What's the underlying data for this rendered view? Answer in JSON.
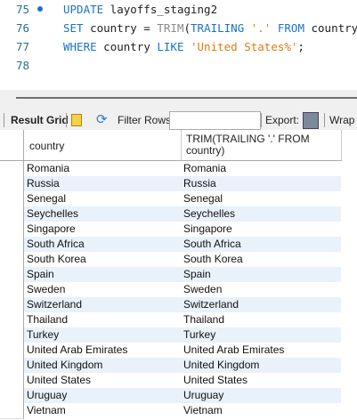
{
  "editor": {
    "lines": [
      {
        "num": "75",
        "parts": [
          [
            "kw",
            "UPDATE"
          ],
          [
            "tx",
            " layoffs_staging2"
          ]
        ]
      },
      {
        "num": "76",
        "parts": [
          [
            "kw",
            "SET"
          ],
          [
            "tx",
            " country = "
          ],
          [
            "fn",
            "TRIM"
          ],
          [
            "tx",
            "("
          ],
          [
            "kw",
            "TRAILING"
          ],
          [
            "str",
            " '.' "
          ],
          [
            "kw",
            "FROM"
          ],
          [
            "tx",
            " country)"
          ]
        ]
      },
      {
        "num": "77",
        "parts": [
          [
            "kw",
            "WHERE"
          ],
          [
            "tx",
            " country "
          ],
          [
            "kw",
            "LIKE"
          ],
          [
            "str",
            " 'United States%'"
          ],
          [
            "tx",
            ";"
          ]
        ]
      },
      {
        "num": "78",
        "parts": []
      }
    ]
  },
  "toolbar": {
    "result_grid": "Result Grid",
    "filter_rows": "Filter Rows:",
    "filter_value": "",
    "export": "Export:",
    "wrap": "Wrap C"
  },
  "grid": {
    "columns": [
      "country",
      "TRIM(TRAILING '.' FROM country)"
    ],
    "rows": [
      [
        "Romania",
        "Romania"
      ],
      [
        "Russia",
        "Russia"
      ],
      [
        "Senegal",
        "Senegal"
      ],
      [
        "Seychelles",
        "Seychelles"
      ],
      [
        "Singapore",
        "Singapore"
      ],
      [
        "South Africa",
        "South Africa"
      ],
      [
        "South Korea",
        "South Korea"
      ],
      [
        "Spain",
        "Spain"
      ],
      [
        "Sweden",
        "Sweden"
      ],
      [
        "Switzerland",
        "Switzerland"
      ],
      [
        "Thailand",
        "Thailand"
      ],
      [
        "Turkey",
        "Turkey"
      ],
      [
        "United Arab Emirates",
        "United Arab Emirates"
      ],
      [
        "United Kingdom",
        "United Kingdom"
      ],
      [
        "United States",
        "United States"
      ],
      [
        "Uruguay",
        "Uruguay"
      ],
      [
        "Vietnam",
        "Vietnam"
      ]
    ]
  }
}
